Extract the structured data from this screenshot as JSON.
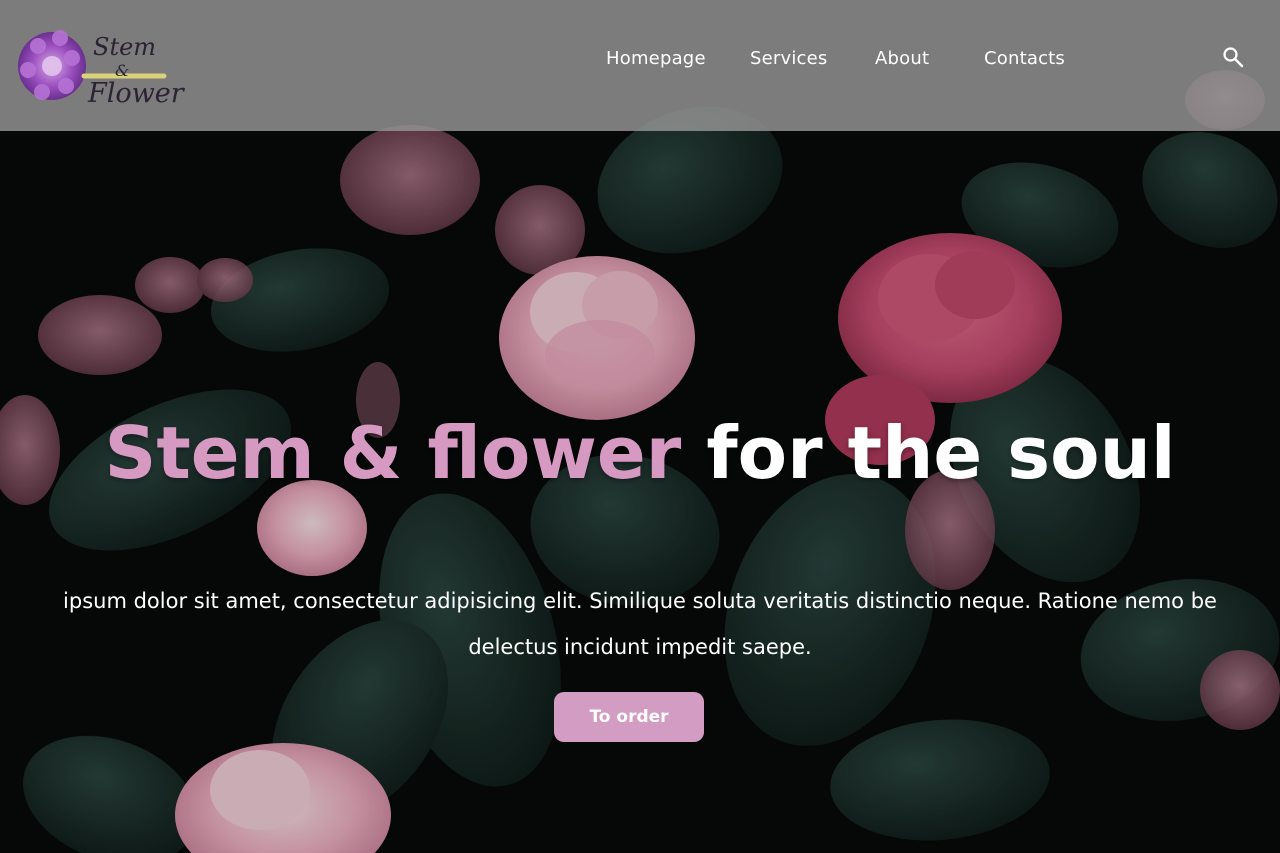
{
  "brand": {
    "logo_line1": "Stem",
    "logo_line2": "&",
    "logo_line3": "Flower",
    "accent_color": "#d69ac2"
  },
  "nav": {
    "items": [
      {
        "label": "Homepage"
      },
      {
        "label": "Services"
      },
      {
        "label": "About"
      },
      {
        "label": "Contacts"
      }
    ],
    "search_icon": "search-icon"
  },
  "hero": {
    "title_accent": "Stem & flower",
    "title_rest": "for the soul",
    "text_line1": "ipsum dolor sit amet, consectetur adipisicing elit. Similique soluta veritatis distinctio neque. Ratione nemo be",
    "text_line2": "delectus incidunt impedit saepe.",
    "button_label": "To order",
    "button_color": "#d39cc2"
  }
}
